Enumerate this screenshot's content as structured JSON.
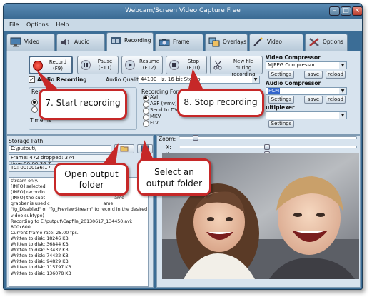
{
  "window": {
    "title": "Webcam/Screen Video Capture Free"
  },
  "menu": [
    "File",
    "Options",
    "Help"
  ],
  "tabs": [
    {
      "label": "Video Source",
      "icon": "monitor-icon"
    },
    {
      "label": "Audio",
      "icon": "speaker-icon"
    },
    {
      "label": "Recording",
      "icon": "film-icon",
      "active": true
    },
    {
      "label": "Frame Grabber",
      "icon": "camera-icon"
    },
    {
      "label": "Overlays",
      "icon": "overlays-icon"
    },
    {
      "label": "Video Processing",
      "icon": "wand-icon"
    },
    {
      "label": "Options",
      "icon": "tools-icon"
    }
  ],
  "controls": {
    "record": {
      "line1": "Record",
      "line2": "(F9)"
    },
    "pause": {
      "line1": "Pause",
      "line2": "(F11)"
    },
    "resume": {
      "line1": "Resume",
      "line2": "(F12)"
    },
    "stop": {
      "line1": "Stop",
      "line2": "(F10)"
    },
    "newfile": {
      "line1": "New file during",
      "line2": "recording"
    }
  },
  "audio": {
    "checkbox_label": "Audio Recording",
    "quality_label": "Audio Quality:",
    "quality_value": "44100 Hz, 16-bit Stereo"
  },
  "recording_mode": {
    "label": "Recordi",
    "timer_label": "Timer is"
  },
  "recording_format": {
    "label": "Recording Format",
    "options": [
      "AVI",
      "ASF (wmv)",
      "Send to DV",
      "MKV",
      "FLV"
    ],
    "selected": 0
  },
  "video_compressor": {
    "label": "Video Compressor",
    "value": "MJPEG Compressor",
    "buttons": [
      "Settings",
      "save",
      "reload"
    ]
  },
  "audio_compressor": {
    "label": "Audio Compressor",
    "value": "PCM",
    "buttons": [
      "Settings",
      "save",
      "reload"
    ]
  },
  "multiplexer": {
    "label": "ultiplexer",
    "button": "Settings"
  },
  "storage": {
    "label": "Storage Path:",
    "path": "E:\\putput\\",
    "frame_status": "Frame: 472 dropped: 374 time:00:00:36 7",
    "tc_status": "TC: 00:00:36:17"
  },
  "log_lines": [
    "stream only.",
    "[INFO] selected",
    "[INFO] recordin",
    "[INFO] the subt",
    "grabber is used c",
    "\"fg_Disabled\" or \"fg_PreviewStream\" to record in the desired",
    "video subtype)",
    "Recording to E:\\putput\\Capfile_20130617_134450.avi:",
    "800x600",
    "Current frame rate: 25.00 fps.",
    "Written to disk: 18246 KB",
    "Written to disk: 36844 KB",
    "Written to disk: 53432 KB",
    "Written to disk: 74422 KB",
    "Written to disk: 94829 KB",
    "Written to disk: 115797 KB",
    "Written to disk: 136078 KB"
  ],
  "log_partial": [
    "ame",
    "ame"
  ],
  "preview": {
    "zoom_label": "Zoom:",
    "x_label": "X:",
    "y_label": "Y:"
  },
  "callouts": {
    "start": "7. Start recording",
    "stop": "8. Stop recording",
    "open_folder": "Open output folder",
    "select_folder": "Select an output folder"
  },
  "colors": {
    "frame": "#3b6d96",
    "panel": "#d7e3ee",
    "callout_border": "#c62828"
  }
}
